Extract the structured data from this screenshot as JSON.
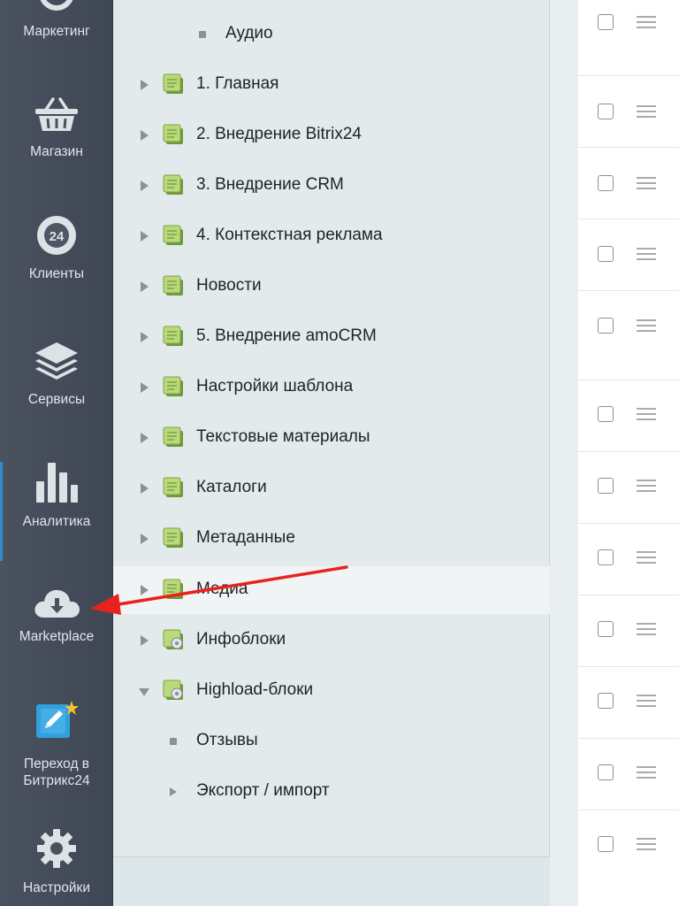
{
  "sidebar": {
    "items": [
      {
        "label": "Маркетинг",
        "icon": "marketing-icon"
      },
      {
        "label": "Магазин",
        "icon": "basket-icon"
      },
      {
        "label": "Клиенты",
        "icon": "clients-24-icon",
        "badge": "24"
      },
      {
        "label": "Сервисы",
        "icon": "layers-icon"
      },
      {
        "label": "Аналитика",
        "icon": "bar-chart-icon"
      },
      {
        "label": "Marketplace",
        "icon": "cloud-download-icon"
      },
      {
        "label_line1": "Переход в",
        "label_line2": "Битрикс24",
        "icon": "bitrix24-go-icon"
      },
      {
        "label": "Настройки",
        "icon": "gear-icon"
      }
    ],
    "active_accent": "#2f8ccc"
  },
  "tree": {
    "rows": [
      {
        "label": "Аудио",
        "type": "leaf"
      },
      {
        "label": "1. Главная",
        "type": "folder"
      },
      {
        "label": "2. Внедрение Bitrix24",
        "type": "folder"
      },
      {
        "label": "3. Внедрение CRM",
        "type": "folder"
      },
      {
        "label": "4. Контекстная реклама",
        "type": "folder"
      },
      {
        "label": "Новости",
        "type": "folder"
      },
      {
        "label": "5. Внедрение amoCRM",
        "type": "folder"
      },
      {
        "label": "Настройки шаблона",
        "type": "folder"
      },
      {
        "label": "Текстовые материалы",
        "type": "folder"
      },
      {
        "label": "Каталоги",
        "type": "folder"
      },
      {
        "label": "Метаданные",
        "type": "folder"
      },
      {
        "label": "Медиа",
        "type": "folder",
        "highlighted": true
      },
      {
        "label": "Инфоблоки",
        "type": "gear-folder"
      },
      {
        "label": "Highload-блоки",
        "type": "gear-folder",
        "expanded": true
      },
      {
        "label": "Отзывы",
        "type": "leaf"
      },
      {
        "label": "Экспорт / импорт",
        "type": "collapsed"
      }
    ]
  },
  "list": {
    "row_count": 12,
    "row_icon": "drag-handle-icon",
    "checkbox_icon": "checkbox-icon"
  },
  "annotation": {
    "arrow_color": "#e8231f",
    "points_to": "Marketplace"
  }
}
